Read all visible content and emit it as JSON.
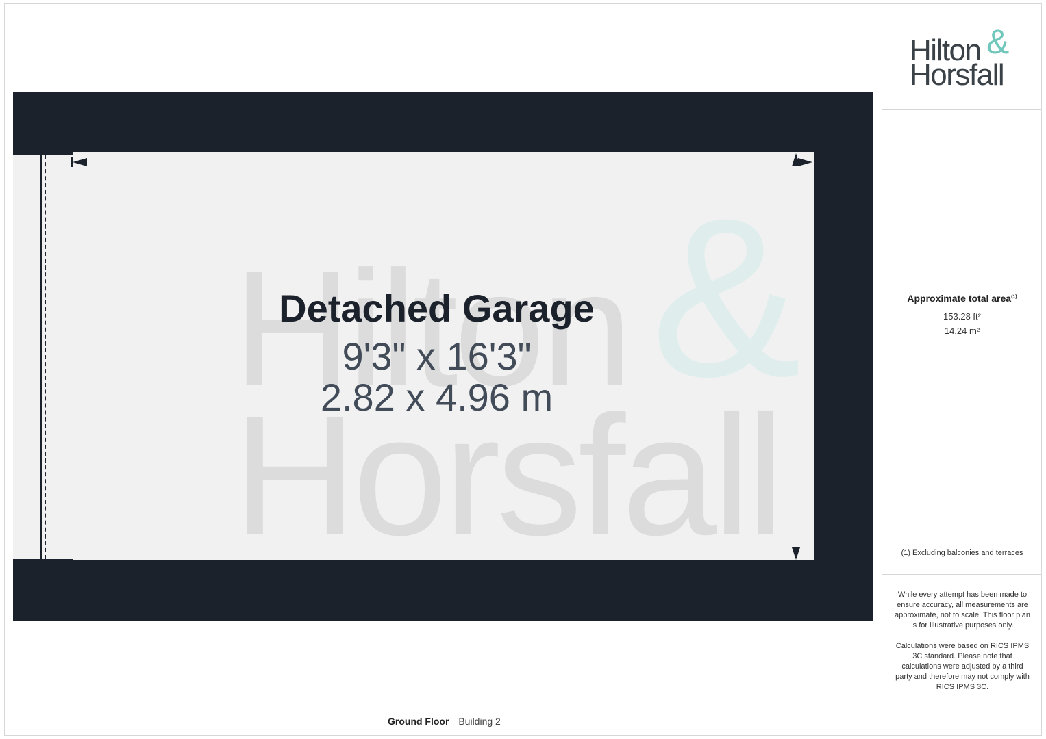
{
  "brand": {
    "line1": "Hilton",
    "amp": "&",
    "line2": "Horsfall",
    "accent_color": "#72c7bd",
    "text_color": "#3a4248"
  },
  "plan": {
    "room_name": "Detached Garage",
    "dimensions_imperial": "9'3\" x 16'3\"",
    "dimensions_metric": "2.82 x 4.96 m",
    "wall_color": "#1c222c",
    "floor_color": "#f1f1f1"
  },
  "area": {
    "title": "Approximate total area",
    "footnote_marker": "(1)",
    "sqft": "153.28 ft²",
    "sqm": "14.24 m²"
  },
  "notes": {
    "footnote": "(1) Excluding balconies and terraces",
    "disclaimer": "While every attempt has been made to ensure accuracy, all measurements are approximate, not to scale. This floor plan is for illustrative purposes only.",
    "calculation": "Calculations were based on RICS IPMS 3C standard. Please note that calculations were adjusted by a third party and therefore may not comply with RICS IPMS 3C."
  },
  "footer": {
    "floor": "Ground Floor",
    "building": "Building 2"
  }
}
